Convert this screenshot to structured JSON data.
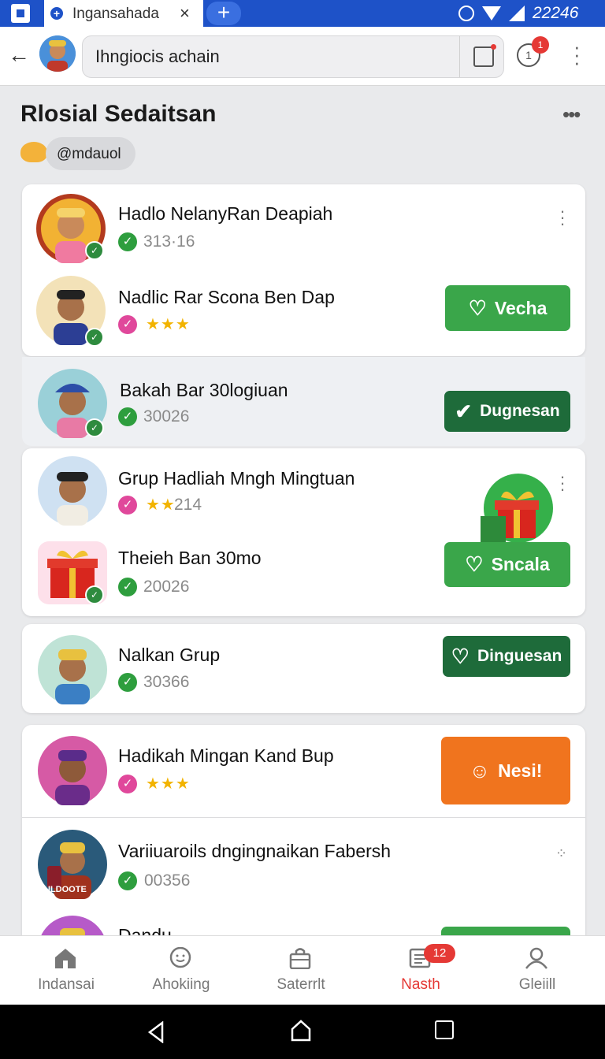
{
  "statusbar": {
    "tab_title": "Ingansahada",
    "tab_close": "×",
    "new_tab": "+",
    "time": "22246"
  },
  "addressbar": {
    "back": "←",
    "url": "Ihngiocis achain",
    "notification_count": "1",
    "notification_glyph": "1"
  },
  "header": {
    "title": "Rlosial Sedaitsan",
    "more": "•••",
    "handle": "@mdauol"
  },
  "groups": [
    {
      "name": "Hadlo NelanyRan Deapiah",
      "meta": "313·16",
      "meta_type": "verified"
    },
    {
      "name": "Nadlic Rar Scona Ben Dap",
      "meta": "★★★",
      "meta_type": "stars",
      "button": "Vecha",
      "button_style": "green"
    },
    {
      "name": "Bakah Bar 30logiuan",
      "meta": "30026",
      "meta_type": "verified",
      "button": "Dugnesan",
      "button_style": "dark"
    },
    {
      "name": "Grup Hadliah Mngh Mingtuan",
      "meta_stars": "★★",
      "meta": "214",
      "meta_type": "stars"
    },
    {
      "name": "Theieh Ban 30mo",
      "meta": "20026",
      "meta_type": "verified",
      "button": "Sncala",
      "button_style": "green"
    },
    {
      "name": "Nalkan Grup",
      "meta": "30366",
      "meta_type": "verified",
      "button": "Dinguesan",
      "button_style": "dark"
    },
    {
      "name": "Hadikah Mingan Kand Bup",
      "meta": "★★★",
      "meta_type": "stars",
      "button": "Nesi!",
      "button_style": "orange"
    },
    {
      "name": "Variiuaroils dngingnaikan Fabersh",
      "meta": "00356",
      "meta_type": "verified"
    },
    {
      "name": "Dandu",
      "meta": "",
      "meta_type": "none"
    }
  ],
  "avatar_caption": "ULDOOTE",
  "bottom_nav": [
    {
      "label": "Indansai",
      "icon": "home-icon"
    },
    {
      "label": "Ahokiing",
      "icon": "chat-icon"
    },
    {
      "label": "Saterrlt",
      "icon": "bag-icon"
    },
    {
      "label": "Nasth",
      "icon": "list-icon",
      "badge": "12",
      "active": true
    },
    {
      "label": "Gleiill",
      "icon": "person-icon"
    }
  ],
  "colors": {
    "accent": "#1e52c8",
    "green": "#3aa64a",
    "dark_green": "#1e6b3a",
    "orange": "#f0741e",
    "red": "#e53935"
  }
}
